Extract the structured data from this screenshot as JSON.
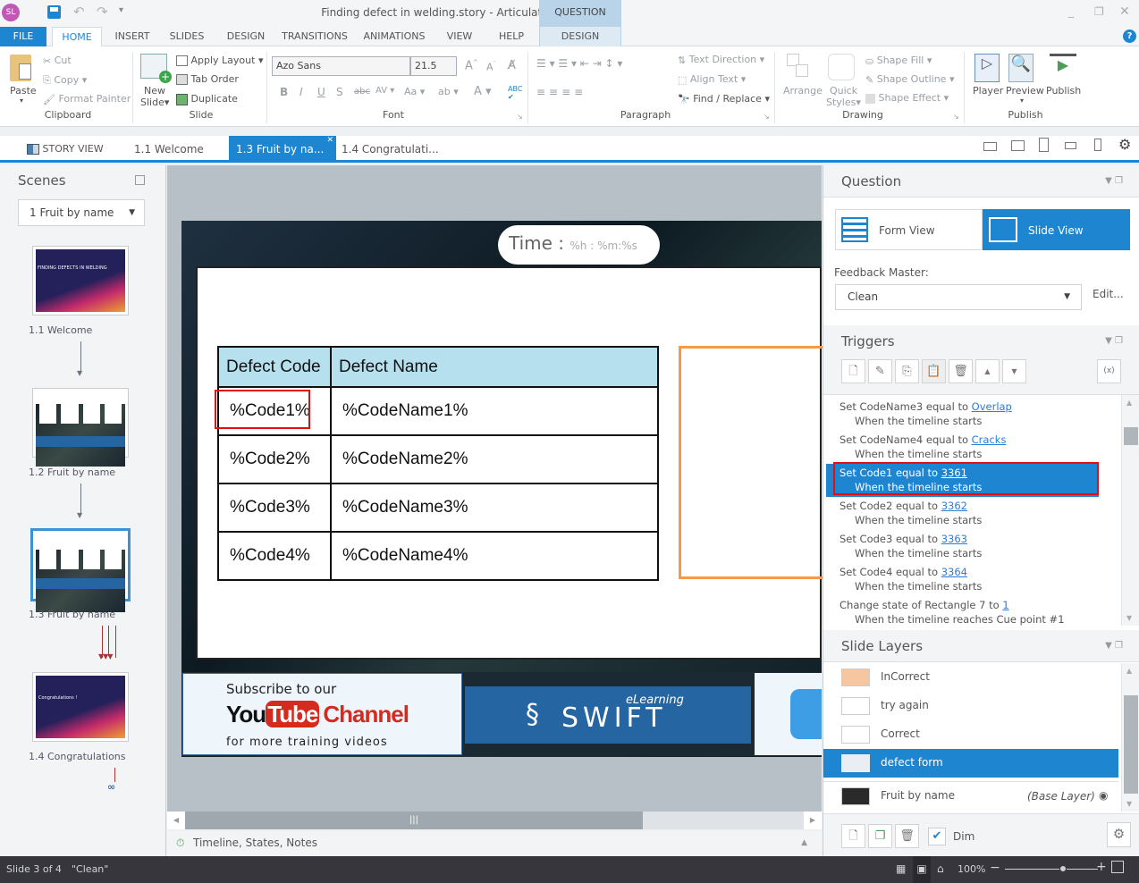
{
  "app": {
    "title": "Finding defect in welding.story -  Articulate Storyline",
    "logo": "SL",
    "context_tab_group": "QUESTION TOOLS"
  },
  "menu_tabs": [
    {
      "label": "FILE"
    },
    {
      "label": "HOME"
    },
    {
      "label": "INSERT"
    },
    {
      "label": "SLIDES"
    },
    {
      "label": "DESIGN"
    },
    {
      "label": "TRANSITIONS"
    },
    {
      "label": "ANIMATIONS"
    },
    {
      "label": "VIEW"
    },
    {
      "label": "HELP"
    },
    {
      "label": "DESIGN"
    }
  ],
  "ribbon": {
    "clipboard": {
      "label": "Clipboard",
      "paste": "Paste",
      "cut": "Cut",
      "copy": "Copy",
      "format_painter": "Format Painter"
    },
    "slide": {
      "label": "Slide",
      "new_slide": "New",
      "new_slide2": "Slide",
      "apply_layout": "Apply Layout",
      "tab_order": "Tab Order",
      "duplicate": "Duplicate"
    },
    "font": {
      "label": "Font",
      "font_name": "Azo Sans",
      "font_size": "21.5"
    },
    "paragraph": {
      "label": "Paragraph",
      "text_direction": "Text Direction",
      "align_text": "Align Text",
      "find_replace": "Find / Replace"
    },
    "drawing": {
      "label": "Drawing",
      "arrange": "Arrange",
      "quick_styles": "Quick",
      "quick_styles2": "Styles",
      "shape_fill": "Shape Fill",
      "shape_outline": "Shape Outline",
      "shape_effect": "Shape Effect"
    },
    "publish": {
      "label": "Publish",
      "player": "Player",
      "preview": "Preview",
      "publish": "Publish"
    }
  },
  "doc_tabs": {
    "story_view": "STORY VIEW",
    "tabs": [
      "1.1 Welcome",
      "1.3 Fruit by na...",
      "1.4 Congratulati..."
    ]
  },
  "scenes": {
    "title": "Scenes",
    "selected_scene": "1 Fruit by name",
    "slides": [
      {
        "label": "1.1 Welcome",
        "thumb_text": "FINDING DEFECTS IN WELDING"
      },
      {
        "label": "1.2 Fruit by name"
      },
      {
        "label": "1.3 Fruit by name"
      },
      {
        "label": "1.4 Congratulations",
        "thumb_text": "Congratulations !"
      }
    ]
  },
  "slide": {
    "time_label": "Time :",
    "time_vars": "%h : %m:%s",
    "table": {
      "headers": [
        "Defect Code",
        "Defect Name"
      ],
      "rows": [
        [
          "%Code1%",
          "%CodeName1%"
        ],
        [
          "%Code2%",
          "%CodeName2%"
        ],
        [
          "%Code3%",
          "%CodeName3%"
        ],
        [
          "%Code4%",
          "%CodeName4%"
        ]
      ]
    },
    "banner": {
      "subscribe": "Subscribe to our",
      "you": "You",
      "tube": "Tube",
      "channel": "Channel",
      "training": "for more training videos",
      "swift_elearning": "eLearning",
      "swift": "SWIFT"
    }
  },
  "timeline_bar": {
    "label": "Timeline, States, Notes"
  },
  "question_panel": {
    "title": "Question",
    "form_view": "Form View",
    "slide_view": "Slide View",
    "feedback_master_label": "Feedback Master:",
    "feedback_master_value": "Clean",
    "edit": "Edit..."
  },
  "triggers": {
    "title": "Triggers",
    "items": [
      {
        "action": "Set CodeName3 equal to ",
        "value": "Overlap",
        "when": "When the timeline starts"
      },
      {
        "action": "Set CodeName4 equal to ",
        "value": "Cracks",
        "when": "When the timeline starts"
      },
      {
        "action": "Set Code1 equal to ",
        "value": "3361",
        "when": "When the timeline starts",
        "selected": true
      },
      {
        "action": "Set Code2 equal to ",
        "value": "3362",
        "when": "When the timeline starts"
      },
      {
        "action": "Set Code3 equal to ",
        "value": "3363",
        "when": "When the timeline starts"
      },
      {
        "action": "Set Code4 equal to ",
        "value": "3364",
        "when": "When the timeline starts"
      },
      {
        "action": "Change state of Rectangle 7 to ",
        "value": "1",
        "when": "When the timeline reaches Cue point #1"
      }
    ]
  },
  "slide_layers": {
    "title": "Slide Layers",
    "items": [
      {
        "name": "InCorrect"
      },
      {
        "name": "try again"
      },
      {
        "name": "Correct"
      },
      {
        "name": "defect form",
        "selected": true
      },
      {
        "name": "Fruit by name",
        "tag": "(Base Layer)"
      }
    ],
    "dim_label": "Dim",
    "dim_checked": true
  },
  "status": {
    "slide_of": "Slide 3 of 4",
    "theme": "\"Clean\"",
    "zoom": "100%",
    "zoom_level_percent": 100
  },
  "colors": {
    "accent": "#1e86d1",
    "highlight_red": "#e01010",
    "table_header": "#b7e0ee",
    "orange_box": "#f59a4a",
    "statusbar": "#38363d"
  }
}
